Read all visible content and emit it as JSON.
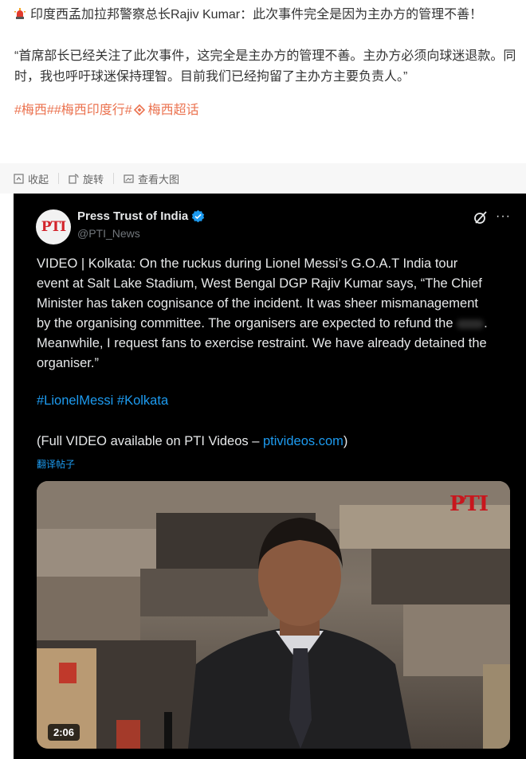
{
  "post": {
    "line1": "印度西孟加拉邦警察总长Rajiv Kumar：此次事件完全是因为主办方的管理不善！",
    "quote": "“首席部长已经关注了此次事件，这完全是主办方的管理不善。主办方必须向球迷退款。同时，我也呼吁球迷保持理智。目前我们已经拘留了主办方主要负责人。”",
    "tags": [
      "#梅西#",
      "#梅西印度行#",
      "梅西超话"
    ]
  },
  "toolbar": {
    "collapse": "收起",
    "rotate": "旋转",
    "view_large": "查看大图"
  },
  "tweet": {
    "account_name": "Press Trust of India",
    "handle": "@PTI_News",
    "avatar_text": "PTI",
    "body_before_redaction": "VIDEO | Kolkata: On the ruckus during Lionel Messi’s G.O.A.T India tour event at Salt Lake Stadium, West Bengal DGP Rajiv Kumar says, “The Chief Minister has taken cognisance of the incident. It was sheer mismanagement by the organising committee. The organisers are expected to refund the",
    "body_after_redaction": ". Meanwhile, I request fans to exercise restraint. We have already detained the organiser.”",
    "hashtags": [
      "#LionelMessi",
      "#Kolkata"
    ],
    "full_video_prefix": "(Full VIDEO available on PTI Videos – ",
    "full_video_link": "ptivideos.com",
    "full_video_suffix": ")",
    "translate": "翻译帖子",
    "video_watermark": "PTI",
    "video_duration": "2:06"
  },
  "colors": {
    "tag_orange": "#eb7350",
    "link_blue": "#1d9bf0",
    "tweet_bg": "#000000",
    "verified_blue": "#1d9bf0"
  }
}
